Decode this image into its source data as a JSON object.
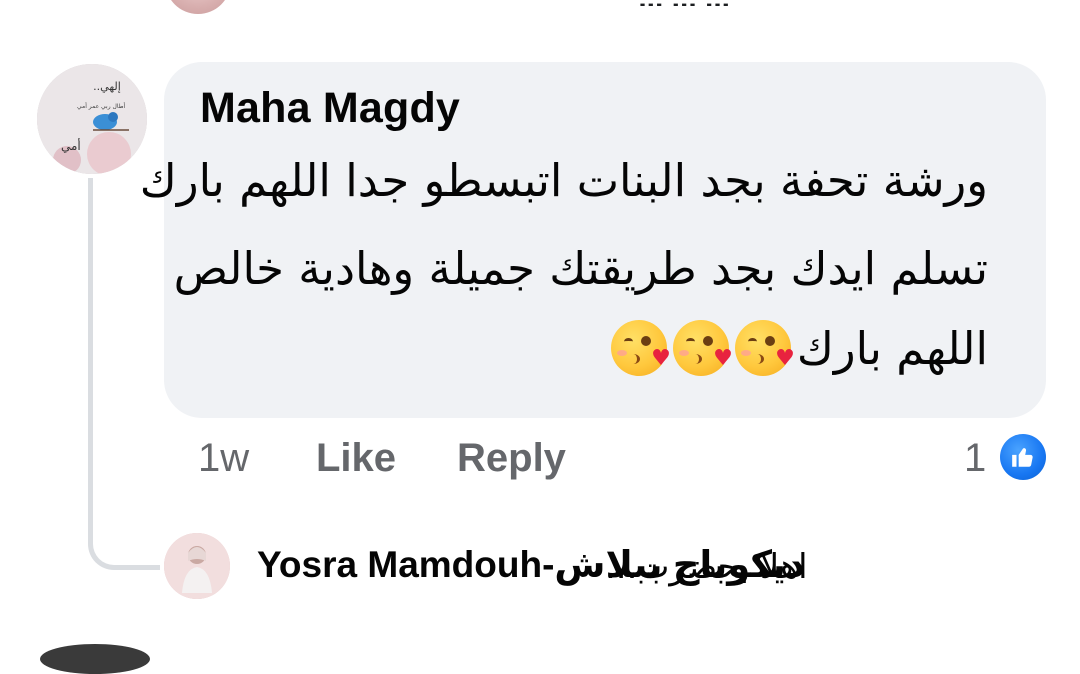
{
  "top_partial_text": "... ... ...",
  "comment": {
    "author": "Maha Magdy",
    "avatar_caption": "إلهي... أمي",
    "lines": [
      "ورشة تحفة بجد البنات اتبسطو جدا اللهم بارك",
      "تسلم ايدك بجد طريقتك جميلة وهادية خالص",
      "اللهم بارك"
    ],
    "emoji_names": [
      "kissing-heart-emoji",
      "kissing-heart-emoji",
      "kissing-heart-emoji"
    ],
    "time": "1w",
    "like_label": "Like",
    "reply_label": "Reply",
    "reaction_count": "1",
    "reaction_type": "like"
  },
  "reply_preview": {
    "author": "Yosra Mamdouh-ديكوباج ببلاش",
    "text": "اهلا بحضرت..."
  },
  "colors": {
    "bubble": "#f0f2f5",
    "meta_text": "#65676b",
    "like_blue": "#1877f2",
    "thread_line": "#dadde1"
  }
}
